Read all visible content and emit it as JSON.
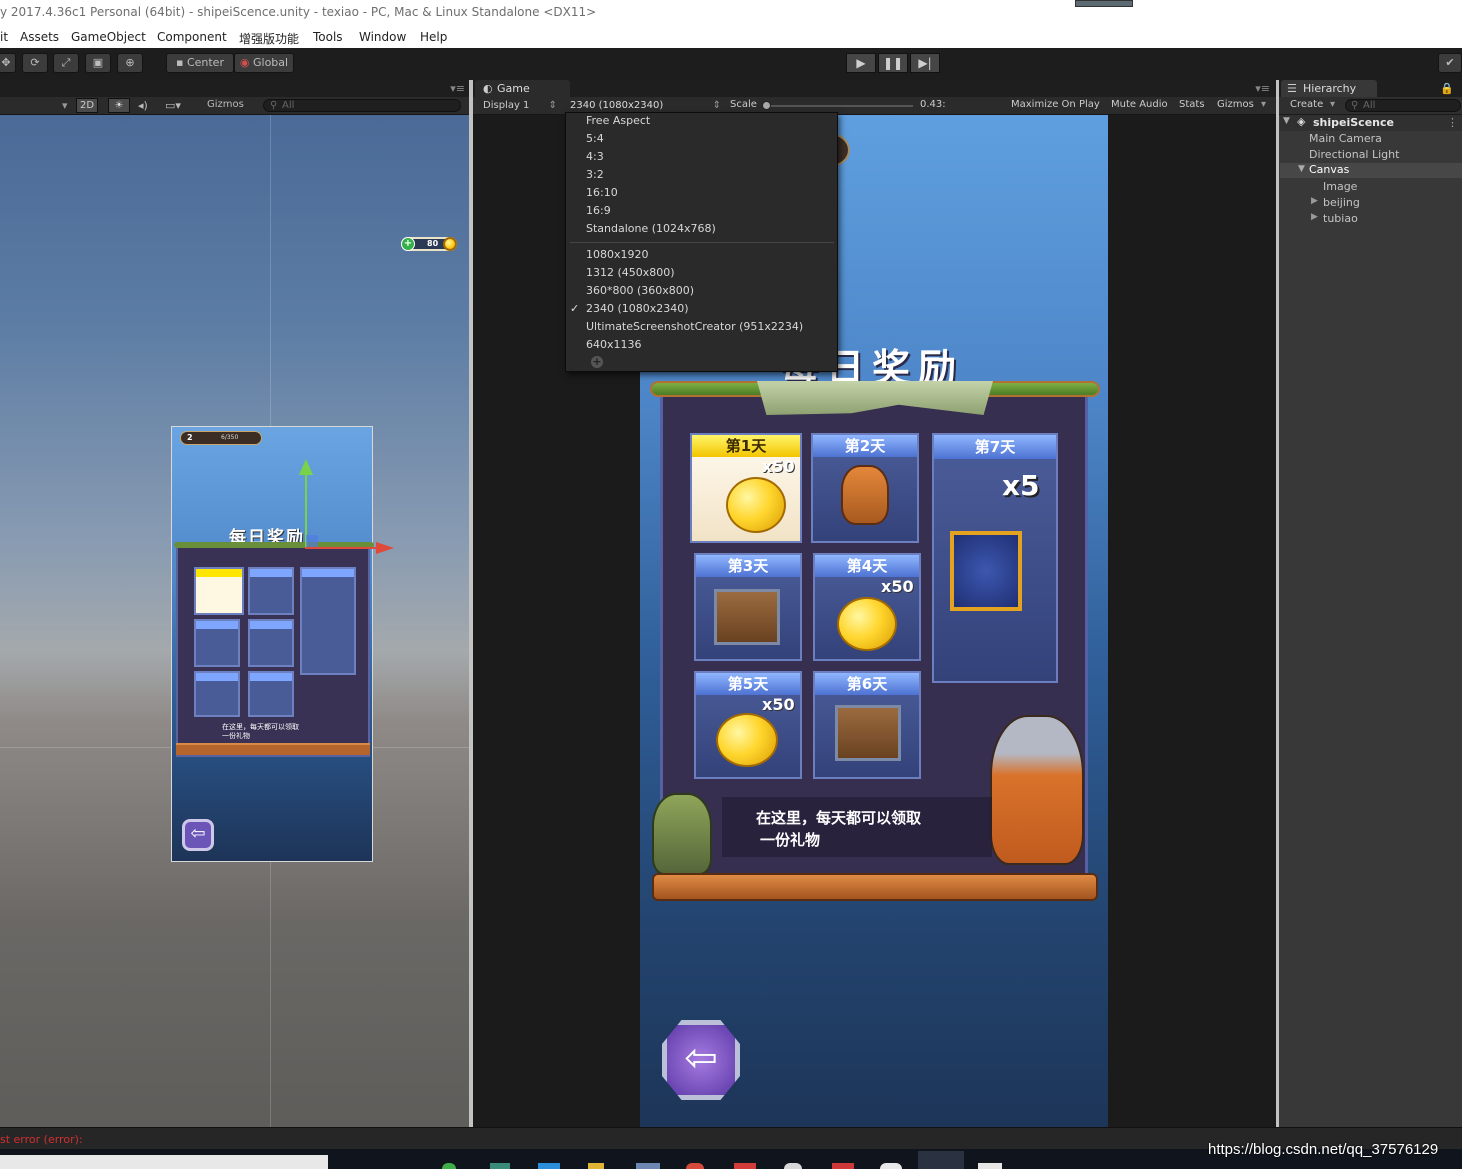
{
  "window": {
    "title": "y 2017.4.36c1 Personal (64bit) - shipeiScence.unity - texiao - PC, Mac & Linux Standalone <DX11>"
  },
  "menu": {
    "items": [
      "it",
      "Assets",
      "GameObject",
      "Component",
      "增强版功能",
      "Tools",
      "Window",
      "Help"
    ]
  },
  "toolbar": {
    "pivot": "Center",
    "space": "Global"
  },
  "scene_toolbar": {
    "mode_2d": "2D",
    "gizmos": "Gizmos",
    "search_placeholder": "All"
  },
  "game": {
    "tab": "Game",
    "display": "Display 1",
    "resolution": "2340 (1080x2340)",
    "scale_label": "Scale",
    "scale_value": "0.43:",
    "scale_fraction": 0.0,
    "maximize": "Maximize On Play",
    "mute": "Mute Audio",
    "stats": "Stats",
    "gizmos": "Gizmos"
  },
  "resolution_menu": {
    "items": [
      "Free Aspect",
      "5:4",
      "4:3",
      "3:2",
      "16:10",
      "16:9",
      "Standalone (1024x768)",
      "1080x1920",
      "1312 (450x800)",
      "360*800 (360x800)",
      "2340 (1080x2340)",
      "UltimateScreenshotCreator (951x2234)",
      "640x1136"
    ],
    "selected": "2340 (1080x2340)"
  },
  "hierarchy": {
    "tab": "Hierarchy",
    "create": "Create",
    "search_placeholder": "All",
    "scene": "shipeiScence",
    "items": [
      "Main Camera",
      "Directional Light",
      "Canvas",
      "Image",
      "beijing",
      "tubiao"
    ]
  },
  "game_ui": {
    "title": "每日奖励",
    "days": [
      "第1天",
      "第2天",
      "第3天",
      "第4天",
      "第5天",
      "第6天",
      "第7天"
    ],
    "multipliers": {
      "coins": "x50",
      "gift": "x5"
    },
    "message_line1": "在这里，每天都可以领取",
    "message_line2": "一份礼物",
    "coin_count": "80"
  },
  "scene_ui": {
    "level": "2",
    "progress": "6/350",
    "title": "每日奖励",
    "message_line1": "在这里，每天都可以领取",
    "message_line2": "一份礼物"
  },
  "status": {
    "error": "st error (error):"
  },
  "watermark": "https://blog.csdn.net/qq_37576129"
}
